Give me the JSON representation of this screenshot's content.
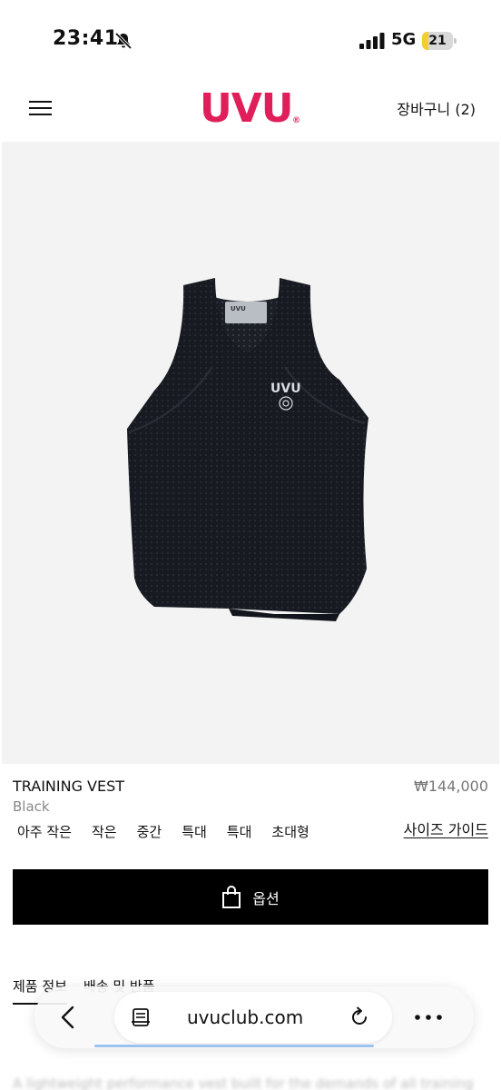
{
  "status_bar": {
    "time": "23:41",
    "network": "5G",
    "battery": "21",
    "battery_level": 0.21,
    "icons": [
      "bell-slash-icon",
      "cellular-signal-icon",
      "battery-icon"
    ],
    "battery_color": "#f2cf2b"
  },
  "header": {
    "logo": "UVU",
    "logo_mark": "®",
    "logo_color": "#e01f5a",
    "cart_label": "장바구니 (2)",
    "menu_icon": "hamburger-menu-icon"
  },
  "product": {
    "image_label": "UVU",
    "name": "TRAINING VEST",
    "price": "₩144,000",
    "color": "Black",
    "sizes": [
      "아주 작은",
      "작은",
      "중간",
      "특대",
      "특대",
      "초대형"
    ],
    "size_guide": "사이즈 가이드",
    "options_button": "옵션",
    "options_icon": "shopping-bag-icon"
  },
  "tabs": [
    {
      "label": "제품 정보",
      "active": true
    },
    {
      "label": "배송 및 반품",
      "active": false
    }
  ],
  "description": "A lightweight performance vest built for the demands of all training",
  "browser": {
    "url": "uvuclub.com",
    "icons": [
      "back-chevron-icon",
      "reader-mode-icon",
      "reload-icon",
      "more-icon"
    ]
  }
}
